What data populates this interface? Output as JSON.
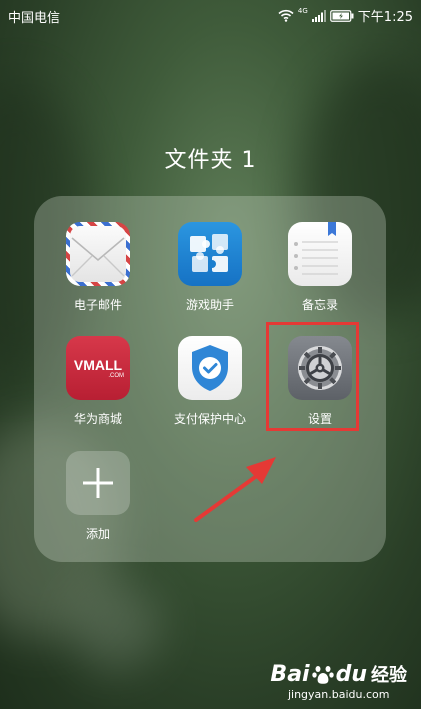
{
  "status_bar": {
    "carrier": "中国电信",
    "network_type": "4G",
    "time": "下午1:25",
    "icons": [
      "wifi-icon",
      "signal-icon",
      "battery-icon"
    ]
  },
  "folder": {
    "title": "文件夹 1",
    "apps": [
      {
        "label": "电子邮件",
        "icon": "envelope-icon"
      },
      {
        "label": "游戏助手",
        "icon": "puzzle-icon"
      },
      {
        "label": "备忘录",
        "icon": "notepad-icon"
      },
      {
        "label": "华为商城",
        "icon": "vmall-icon",
        "icon_text": "VMALL",
        "icon_subtext": ".COM"
      },
      {
        "label": "支付保护中心",
        "icon": "shield-check-icon"
      },
      {
        "label": "设置",
        "icon": "gear-icon"
      },
      {
        "label": "添加",
        "icon": "plus-icon"
      }
    ]
  },
  "watermark": {
    "logo_part1": "Bai",
    "logo_part2": "du",
    "logo_suffix": "经验",
    "url": "jingyan.baidu.com"
  },
  "colors": {
    "highlight": "#e53935",
    "arrow": "#e53935",
    "vmall_red": "#c8273a",
    "game_blue": "#1e88d6",
    "shield_blue": "#2f86d6",
    "settings_gray": "#6e7278"
  }
}
